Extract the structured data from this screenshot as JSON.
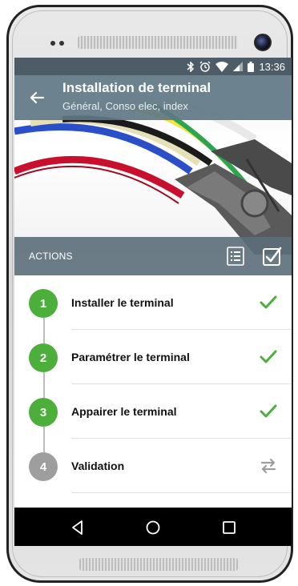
{
  "status_bar": {
    "time": "13:36",
    "icons": [
      "bluetooth-icon",
      "alarm-icon",
      "wifi-icon",
      "signal-icon",
      "battery-icon"
    ]
  },
  "header": {
    "title": "Installation de terminal",
    "subtitle": "Général, Conso elec, index",
    "back_icon": "back-arrow-icon"
  },
  "actions_bar": {
    "label": "ACTIONS",
    "icons": [
      "list-icon",
      "checkbox-icon"
    ]
  },
  "steps": [
    {
      "number": "1",
      "label": "Installer le terminal",
      "state": "done",
      "status_icon": "check-icon"
    },
    {
      "number": "2",
      "label": "Paramétrer le terminal",
      "state": "done",
      "status_icon": "check-icon"
    },
    {
      "number": "3",
      "label": "Appairer le terminal",
      "state": "done",
      "status_icon": "check-icon"
    },
    {
      "number": "4",
      "label": "Validation",
      "state": "pending",
      "status_icon": "swap-icon"
    }
  ],
  "nav_bar": {
    "icons": [
      "back-triangle-icon",
      "home-circle-icon",
      "recents-square-icon"
    ]
  },
  "colors": {
    "done": "#4caf3c",
    "pending": "#9e9e9e",
    "header": "#607784",
    "status_bar": "#4d5c66"
  }
}
